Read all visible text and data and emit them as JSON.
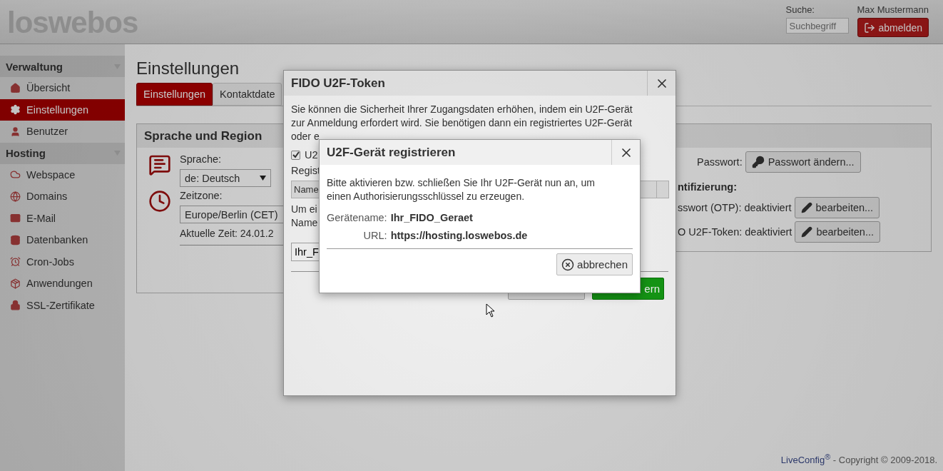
{
  "header": {
    "logo": "loswebos",
    "search_label": "Suche:",
    "search_placeholder": "Suchbegriff",
    "user": "Max Mustermann",
    "logout_button": "abmelden"
  },
  "sidebar": {
    "sections": [
      {
        "title": "Verwaltung",
        "items": [
          {
            "label": "Übersicht",
            "selected": false
          },
          {
            "label": "Einstellungen",
            "selected": true
          },
          {
            "label": "Benutzer",
            "selected": false
          }
        ]
      },
      {
        "title": "Hosting",
        "items": [
          {
            "label": "Webspace",
            "selected": false
          },
          {
            "label": "Domains",
            "selected": false
          },
          {
            "label": "E-Mail",
            "selected": false
          },
          {
            "label": "Datenbanken",
            "selected": false
          },
          {
            "label": "Cron-Jobs",
            "selected": false
          },
          {
            "label": "Anwendungen",
            "selected": false
          },
          {
            "label": "SSL-Zertifikate",
            "selected": false
          }
        ]
      }
    ]
  },
  "page": {
    "title": "Einstellungen",
    "tabs": [
      {
        "label": "Einstellungen",
        "selected": true
      },
      {
        "label": "Kontaktdate",
        "selected": false
      }
    ]
  },
  "panel": {
    "title": "Sprache und Region",
    "language_label": "Sprache:",
    "language_value": "de: Deutsch",
    "timezone_label": "Zeitzone:",
    "timezone_value": "Europe/Berlin (CET)",
    "current_time": "Aktuelle Zeit: 24.01.2",
    "password_label": "Passwort:",
    "password_button": "Passwort ändern...",
    "twofa_heading": "ntifizierung:",
    "twofa_rows": [
      {
        "label": "sswort (OTP): deaktiviert",
        "button": "bearbeiten..."
      },
      {
        "label": "O U2F-Token: deaktiviert",
        "button": "bearbeiten..."
      }
    ]
  },
  "fido_dialog": {
    "title": "FIDO U2F-Token",
    "intro_lines": [
      "Sie können die Sicherheit Ihrer Zugangsdaten erhöhen, indem ein U2F-Gerät",
      "zur Anmeldung erfordert wird. Sie benötigen dann ein registriertes U2F-Gerät",
      "oder e"
    ],
    "u2f_checkbox": {
      "label": "U2",
      "checked": true
    },
    "register_label": "Regist",
    "table_header": "Name",
    "hint_lines": [
      "Um ei",
      "Name"
    ],
    "name_input": "Ihr_F",
    "save_button": "ern"
  },
  "register_dialog": {
    "title": "U2F-Gerät registrieren",
    "message_lines": [
      "Bitte aktivieren bzw. schließen Sie Ihr U2F-Gerät nun an, um",
      "einen Authorisierungsschlüssel zu erzeugen."
    ],
    "fields": [
      {
        "label": "Gerätename:",
        "value": "Ihr_FIDO_Geraet"
      },
      {
        "label": "URL:",
        "value": "https://hosting.loswebos.de"
      }
    ],
    "cancel_button": "abbrechen"
  },
  "footer": {
    "brand": "LiveConfig$^{®}$",
    "text": " - Copyright © 2009-2018."
  }
}
